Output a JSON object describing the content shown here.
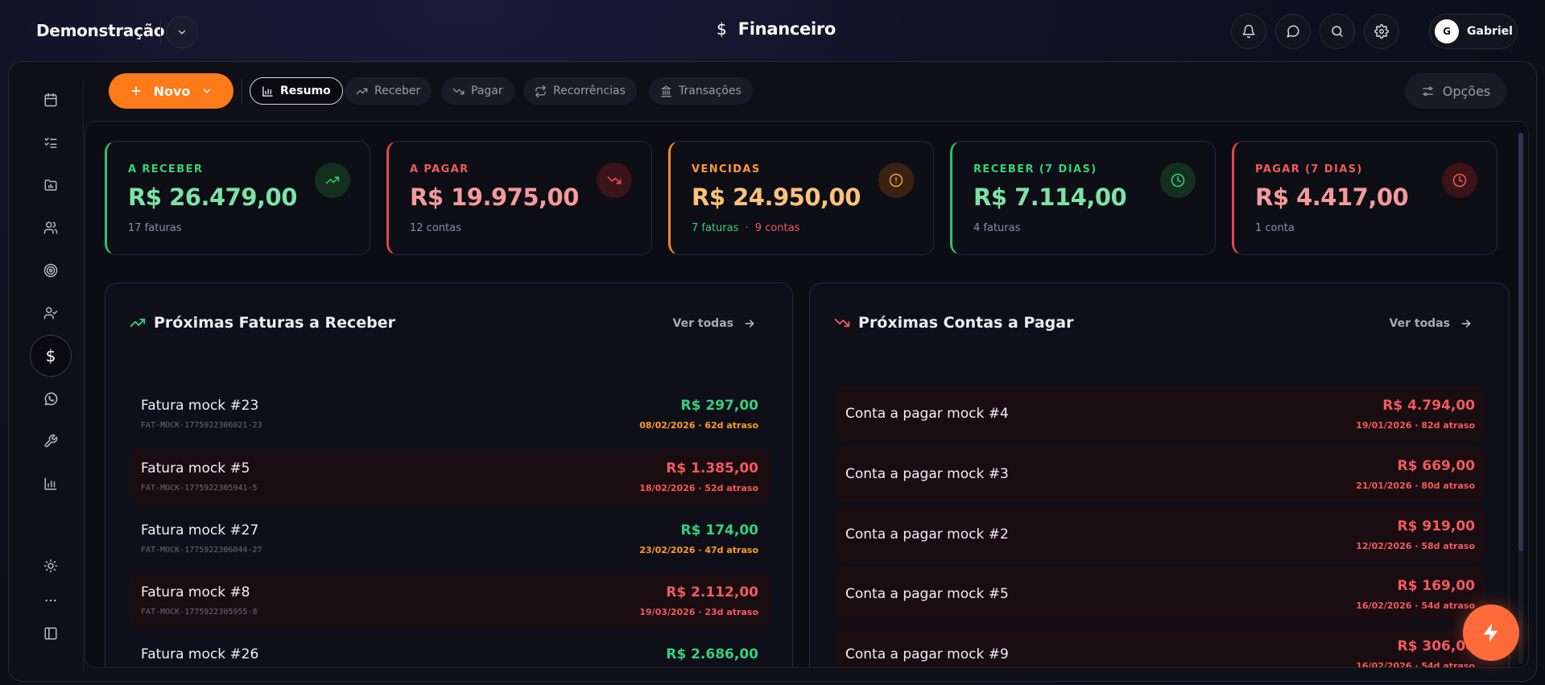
{
  "colors": {
    "accent": "#ff7a18",
    "green": "#34d17a",
    "red": "#f25a5a",
    "orange": "#ff9a2e",
    "pink": "#f08d8d"
  },
  "header": {
    "workspace": "Demonstração",
    "title": "Financeiro",
    "user_initial": "G",
    "user_name": "Gabriel"
  },
  "toolbar": {
    "new_label": "Novo",
    "tabs": [
      {
        "label": "Resumo",
        "icon": "bar-chart-icon"
      },
      {
        "label": "Receber",
        "icon": "trend-up-icon"
      },
      {
        "label": "Pagar",
        "icon": "trend-down-icon"
      },
      {
        "label": "Recorrências",
        "icon": "repeat-icon"
      },
      {
        "label": "Transações",
        "icon": "bank-icon"
      }
    ],
    "options_label": "Opções"
  },
  "cards": [
    {
      "label": "A RECEBER",
      "value": "R$ 26.479,00",
      "sub": "17 faturas"
    },
    {
      "label": "A PAGAR",
      "value": "R$ 19.975,00",
      "sub": "12 contas"
    },
    {
      "label": "VENCIDAS",
      "value": "R$ 24.950,00",
      "sub_a": "7 faturas",
      "sep": "·",
      "sub_b": "9 contas"
    },
    {
      "label": "RECEBER (7 DIAS)",
      "value": "R$ 7.114,00",
      "sub": "4 faturas"
    },
    {
      "label": "PAGAR (7 DIAS)",
      "value": "R$ 4.417,00",
      "sub": "1 conta"
    }
  ],
  "receivables": {
    "title": "Próximas Faturas a Receber",
    "view_all": "Ver todas",
    "rows": [
      {
        "name": "Fatura mock #23",
        "code": "FAT-MOCK-1775922306021-23",
        "amount": "R$ 297,00",
        "date": "08/02/2026 · 62d atraso"
      },
      {
        "name": "Fatura mock #5",
        "code": "FAT-MOCK-1775922305941-5",
        "amount": "R$ 1.385,00",
        "date": "18/02/2026 · 52d atraso"
      },
      {
        "name": "Fatura mock #27",
        "code": "FAT-MOCK-1775922306044-27",
        "amount": "R$ 174,00",
        "date": "23/02/2026 · 47d atraso"
      },
      {
        "name": "Fatura mock #8",
        "code": "FAT-MOCK-1775922305955-8",
        "amount": "R$ 2.112,00",
        "date": "19/03/2026 · 23d atraso"
      },
      {
        "name": "Fatura mock #26",
        "code": "",
        "amount": "R$ 2.686,00",
        "date": ""
      }
    ]
  },
  "payables": {
    "title": "Próximas Contas a Pagar",
    "view_all": "Ver todas",
    "rows": [
      {
        "name": "Conta a pagar mock #4",
        "amount": "R$ 4.794,00",
        "date": "19/01/2026 · 82d atraso"
      },
      {
        "name": "Conta a pagar mock #3",
        "amount": "R$ 669,00",
        "date": "21/01/2026 · 80d atraso"
      },
      {
        "name": "Conta a pagar mock #2",
        "amount": "R$ 919,00",
        "date": "12/02/2026 · 58d atraso"
      },
      {
        "name": "Conta a pagar mock #5",
        "amount": "R$ 169,00",
        "date": "16/02/2026 · 54d atraso"
      },
      {
        "name": "Conta a pagar mock #9",
        "amount": "R$ 306,00",
        "date": "16/02/2026 · 54d atraso"
      }
    ]
  }
}
